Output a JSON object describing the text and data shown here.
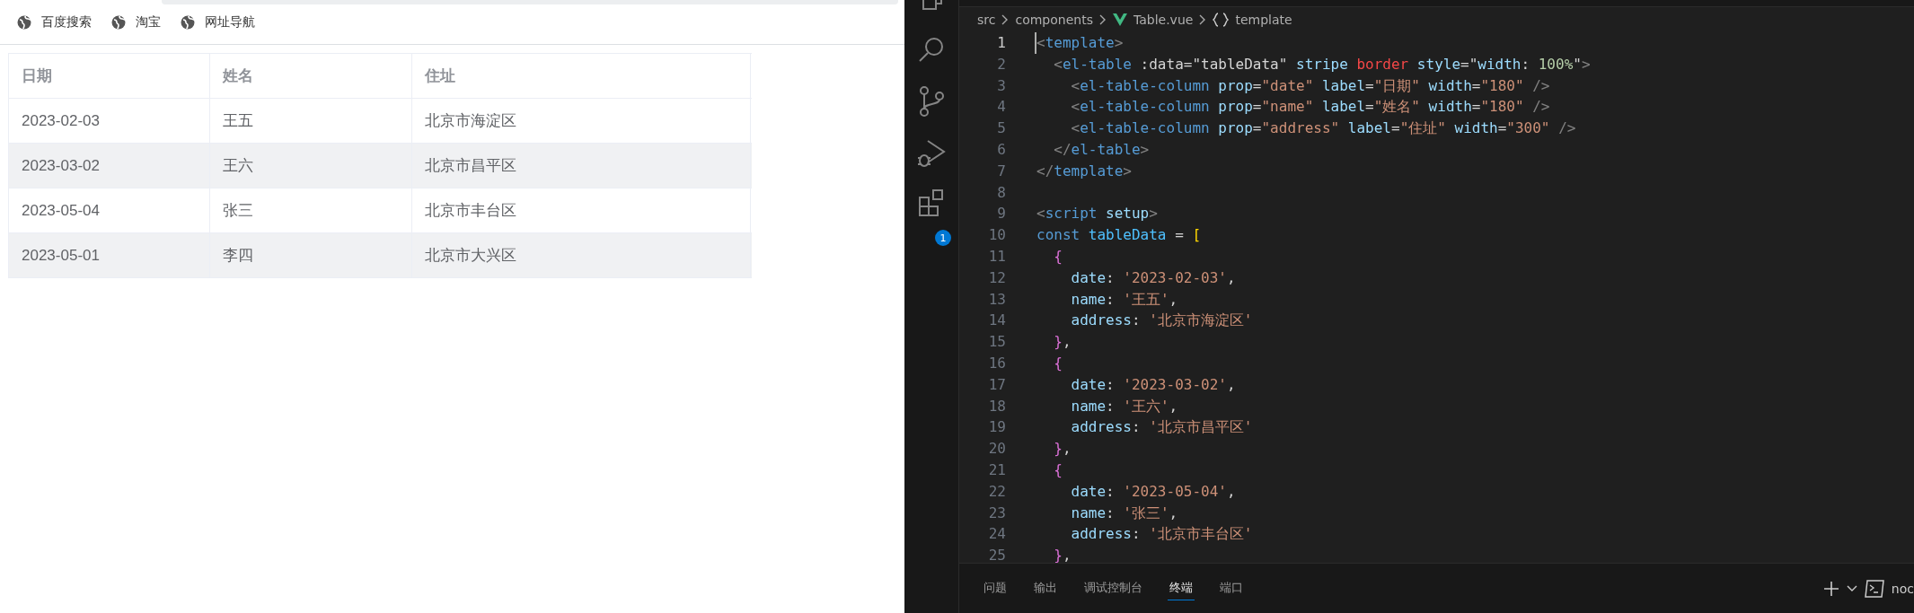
{
  "browser": {
    "bookmarks": [
      {
        "label": "百度搜索"
      },
      {
        "label": "淘宝"
      },
      {
        "label": "网址导航"
      }
    ],
    "table": {
      "columns": [
        "日期",
        "姓名",
        "住址"
      ],
      "rows": [
        {
          "striped": false,
          "cells": [
            "2023-02-03",
            "王五",
            "北京市海淀区"
          ]
        },
        {
          "striped": true,
          "cells": [
            "2023-03-02",
            "王六",
            "北京市昌平区"
          ]
        },
        {
          "striped": false,
          "cells": [
            "2023-05-04",
            "张三",
            "北京市丰台区"
          ]
        },
        {
          "striped": true,
          "cells": [
            "2023-05-01",
            "李四",
            "北京市大兴区"
          ]
        }
      ]
    }
  },
  "editor": {
    "activity_bar": {
      "extensions_badge": "1"
    },
    "breadcrumb": [
      {
        "kind": "folder",
        "text": "src"
      },
      {
        "kind": "folder",
        "text": "components"
      },
      {
        "kind": "vue-file",
        "text": "Table.vue"
      },
      {
        "kind": "symbol",
        "text": "template"
      }
    ],
    "lines": [
      {
        "number": "1",
        "active": true,
        "tokens": [
          {
            "kind": "p",
            "text": "<"
          },
          {
            "kind": "tag",
            "text": "template"
          },
          {
            "kind": "p",
            "text": ">"
          }
        ]
      },
      {
        "number": "2",
        "active": false,
        "tokens": [
          {
            "kind": "p",
            "text": "  <"
          },
          {
            "kind": "tag",
            "text": "el-table"
          },
          {
            "kind": "txt",
            "text": " :data=\"tableData\""
          },
          {
            "kind": "attr",
            "text": " stripe"
          },
          {
            "kind": "err",
            "text": " border"
          },
          {
            "kind": "attr",
            "text": " style"
          },
          {
            "kind": "txt",
            "text": "=\""
          },
          {
            "kind": "attr",
            "text": "width"
          },
          {
            "kind": "txt",
            "text": ": "
          },
          {
            "kind": "num",
            "text": "100%"
          },
          {
            "kind": "txt",
            "text": "\""
          },
          {
            "kind": "p",
            "text": ">"
          }
        ]
      },
      {
        "number": "3",
        "active": false,
        "tokens": [
          {
            "kind": "p",
            "text": "    <"
          },
          {
            "kind": "tag",
            "text": "el-table-column"
          },
          {
            "kind": "attr",
            "text": " prop"
          },
          {
            "kind": "txt",
            "text": "="
          },
          {
            "kind": "str",
            "text": "\"date\""
          },
          {
            "kind": "attr",
            "text": " label"
          },
          {
            "kind": "txt",
            "text": "="
          },
          {
            "kind": "str",
            "text": "\"日期\""
          },
          {
            "kind": "attr",
            "text": " width"
          },
          {
            "kind": "txt",
            "text": "="
          },
          {
            "kind": "str",
            "text": "\"180\""
          },
          {
            "kind": "p",
            "text": " />"
          }
        ]
      },
      {
        "number": "4",
        "active": false,
        "tokens": [
          {
            "kind": "p",
            "text": "    <"
          },
          {
            "kind": "tag",
            "text": "el-table-column"
          },
          {
            "kind": "attr",
            "text": " prop"
          },
          {
            "kind": "txt",
            "text": "="
          },
          {
            "kind": "str",
            "text": "\"name\""
          },
          {
            "kind": "attr",
            "text": " label"
          },
          {
            "kind": "txt",
            "text": "="
          },
          {
            "kind": "str",
            "text": "\"姓名\""
          },
          {
            "kind": "attr",
            "text": " width"
          },
          {
            "kind": "txt",
            "text": "="
          },
          {
            "kind": "str",
            "text": "\"180\""
          },
          {
            "kind": "p",
            "text": " />"
          }
        ]
      },
      {
        "number": "5",
        "active": false,
        "tokens": [
          {
            "kind": "p",
            "text": "    <"
          },
          {
            "kind": "tag",
            "text": "el-table-column"
          },
          {
            "kind": "attr",
            "text": " prop"
          },
          {
            "kind": "txt",
            "text": "="
          },
          {
            "kind": "str",
            "text": "\"address\""
          },
          {
            "kind": "attr",
            "text": " label"
          },
          {
            "kind": "txt",
            "text": "="
          },
          {
            "kind": "str",
            "text": "\"住址\""
          },
          {
            "kind": "attr",
            "text": " width"
          },
          {
            "kind": "txt",
            "text": "="
          },
          {
            "kind": "str",
            "text": "\"300\""
          },
          {
            "kind": "p",
            "text": " />"
          }
        ]
      },
      {
        "number": "6",
        "active": false,
        "tokens": [
          {
            "kind": "p",
            "text": "  </"
          },
          {
            "kind": "tag",
            "text": "el-table"
          },
          {
            "kind": "p",
            "text": ">"
          }
        ]
      },
      {
        "number": "7",
        "active": false,
        "tokens": [
          {
            "kind": "p",
            "text": "</"
          },
          {
            "kind": "tag",
            "text": "template"
          },
          {
            "kind": "p",
            "text": ">"
          }
        ]
      },
      {
        "number": "8",
        "active": false
      },
      {
        "number": "9",
        "active": false,
        "tokens": [
          {
            "kind": "p",
            "text": "<"
          },
          {
            "kind": "tag",
            "text": "script"
          },
          {
            "kind": "attr",
            "text": " setup"
          },
          {
            "kind": "p",
            "text": ">"
          }
        ]
      },
      {
        "number": "10",
        "active": false,
        "tokens": [
          {
            "kind": "kw",
            "text": "const"
          },
          {
            "kind": "var",
            "text": " tableData"
          },
          {
            "kind": "txt",
            "text": " = "
          },
          {
            "kind": "brk",
            "text": "["
          }
        ]
      },
      {
        "number": "11",
        "active": false,
        "tokens": [
          {
            "kind": "brc",
            "text": "  {"
          }
        ]
      },
      {
        "number": "12",
        "active": false,
        "tokens": [
          {
            "kind": "attr",
            "text": "    date"
          },
          {
            "kind": "txt",
            "text": ": "
          },
          {
            "kind": "str",
            "text": "'2023-02-03'"
          },
          {
            "kind": "txt",
            "text": ","
          }
        ]
      },
      {
        "number": "13",
        "active": false,
        "tokens": [
          {
            "kind": "attr",
            "text": "    name"
          },
          {
            "kind": "txt",
            "text": ": "
          },
          {
            "kind": "str",
            "text": "'王五'"
          },
          {
            "kind": "txt",
            "text": ","
          }
        ]
      },
      {
        "number": "14",
        "active": false,
        "tokens": [
          {
            "kind": "attr",
            "text": "    address"
          },
          {
            "kind": "txt",
            "text": ": "
          },
          {
            "kind": "str",
            "text": "'北京市海淀区'"
          }
        ]
      },
      {
        "number": "15",
        "active": false,
        "tokens": [
          {
            "kind": "brc",
            "text": "  }"
          },
          {
            "kind": "txt",
            "text": ","
          }
        ]
      },
      {
        "number": "16",
        "active": false,
        "tokens": [
          {
            "kind": "brc",
            "text": "  {"
          }
        ]
      },
      {
        "number": "17",
        "active": false,
        "tokens": [
          {
            "kind": "attr",
            "text": "    date"
          },
          {
            "kind": "txt",
            "text": ": "
          },
          {
            "kind": "str",
            "text": "'2023-03-02'"
          },
          {
            "kind": "txt",
            "text": ","
          }
        ]
      },
      {
        "number": "18",
        "active": false,
        "tokens": [
          {
            "kind": "attr",
            "text": "    name"
          },
          {
            "kind": "txt",
            "text": ": "
          },
          {
            "kind": "str",
            "text": "'王六'"
          },
          {
            "kind": "txt",
            "text": ","
          }
        ]
      },
      {
        "number": "19",
        "active": false,
        "tokens": [
          {
            "kind": "attr",
            "text": "    address"
          },
          {
            "kind": "txt",
            "text": ": "
          },
          {
            "kind": "str",
            "text": "'北京市昌平区'"
          }
        ]
      },
      {
        "number": "20",
        "active": false,
        "tokens": [
          {
            "kind": "brc",
            "text": "  }"
          },
          {
            "kind": "txt",
            "text": ","
          }
        ]
      },
      {
        "number": "21",
        "active": false,
        "tokens": [
          {
            "kind": "brc",
            "text": "  {"
          }
        ]
      },
      {
        "number": "22",
        "active": false,
        "tokens": [
          {
            "kind": "attr",
            "text": "    date"
          },
          {
            "kind": "txt",
            "text": ": "
          },
          {
            "kind": "str",
            "text": "'2023-05-04'"
          },
          {
            "kind": "txt",
            "text": ","
          }
        ]
      },
      {
        "number": "23",
        "active": false,
        "tokens": [
          {
            "kind": "attr",
            "text": "    name"
          },
          {
            "kind": "txt",
            "text": ": "
          },
          {
            "kind": "str",
            "text": "'张三'"
          },
          {
            "kind": "txt",
            "text": ","
          }
        ]
      },
      {
        "number": "24",
        "active": false,
        "tokens": [
          {
            "kind": "attr",
            "text": "    address"
          },
          {
            "kind": "txt",
            "text": ": "
          },
          {
            "kind": "str",
            "text": "'北京市丰台区'"
          }
        ]
      },
      {
        "number": "25",
        "active": false,
        "tokens": [
          {
            "kind": "brc",
            "text": "  }"
          },
          {
            "kind": "txt",
            "text": ","
          }
        ]
      }
    ],
    "panel": {
      "tabs": [
        {
          "label": "问题",
          "selected": false
        },
        {
          "label": "输出",
          "selected": false
        },
        {
          "label": "调试控制台",
          "selected": false
        },
        {
          "label": "终端",
          "selected": true
        },
        {
          "label": "端口",
          "selected": false
        }
      ],
      "terminal_name": "noc"
    }
  }
}
